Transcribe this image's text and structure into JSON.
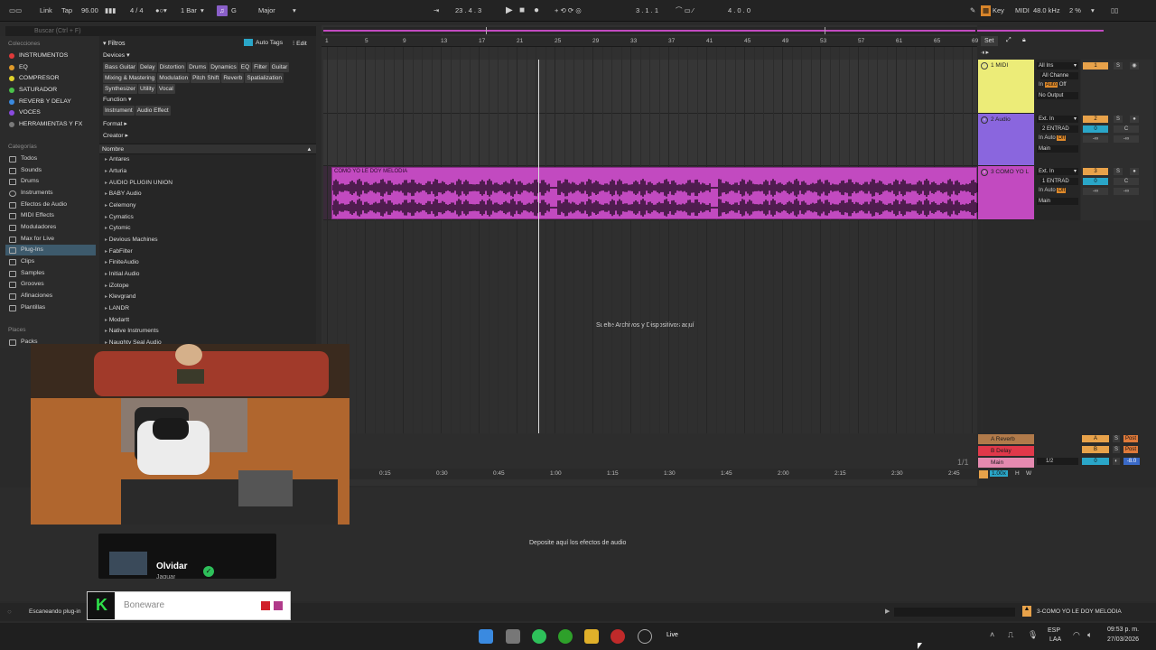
{
  "topbar": {
    "link": "Link",
    "tap": "Tap",
    "tempo": "96.00",
    "time_sig": "4 / 4",
    "quantize": "1 Bar",
    "key": "G",
    "scale": "Major",
    "position": "23 .  4 .  3",
    "loop_start": "3 .  1 .  1",
    "loop_length": "4 .  0 .  0",
    "key_label": "Key",
    "midi_label": "MIDI",
    "sample_rate": "48.0 kHz",
    "cpu": "2 %"
  },
  "browser": {
    "search_placeholder": "Buscar (Ctrl + F)",
    "collections_header": "Colecciones",
    "collections": [
      {
        "label": "INSTRUMENTOS",
        "color": "#e03a3a"
      },
      {
        "label": "EQ",
        "color": "#e09a2a"
      },
      {
        "label": "COMPRESOR",
        "color": "#e0d22a"
      },
      {
        "label": "SATURADOR",
        "color": "#4ac24a"
      },
      {
        "label": "REVERB Y DELAY",
        "color": "#3a8ae0"
      },
      {
        "label": "VOCES",
        "color": "#8a4ae0"
      },
      {
        "label": "HERRAMIENTAS Y FX",
        "color": "#7a7a7a"
      }
    ],
    "categories_header": "Categorías",
    "categories": [
      "Todos",
      "Sounds",
      "Drums",
      "Instruments",
      "Efectos de Audio",
      "MIDI Effects",
      "Moduladores",
      "Max for Live",
      "Plug-Ins",
      "Clips",
      "Samples",
      "Grooves",
      "Afinaciones",
      "Plantillas"
    ],
    "places_header": "Places",
    "places": [
      "Packs"
    ],
    "filters_label": "Filtros",
    "auto_tags": "Auto Tags",
    "edit": "Edit",
    "devices_label": "Devices",
    "device_tags": [
      "Bass Guitar",
      "Delay",
      "Distortion",
      "Drums",
      "Dynamics",
      "EQ",
      "Filter",
      "Guitar",
      "Mixing & Mastering",
      "Modulation",
      "Pitch Shift",
      "Reverb",
      "Spatialization",
      "Synthesizer",
      "Utility",
      "Vocal"
    ],
    "function_label": "Function",
    "function_tags": [
      "Instrument",
      "Audio Effect"
    ],
    "format_label": "Format",
    "creator_label": "Creator",
    "name_header": "Nombre",
    "folders": [
      "Antares",
      "Arturia",
      "AUDIO PLUGIN UNION",
      "BABY Audio",
      "Celemony",
      "Cymatics",
      "Cytomic",
      "Devious Machines",
      "FabFilter",
      "FiniteAudio",
      "Initial Audio",
      "iZotope",
      "Klevgrand",
      "LANDR",
      "Modartt",
      "Native Instruments",
      "Naughty Seal Audio"
    ]
  },
  "arrangement": {
    "ruler_labels": [
      "1",
      "5",
      "9",
      "13",
      "17",
      "21",
      "25",
      "29",
      "33",
      "37",
      "41",
      "45",
      "49",
      "53",
      "57",
      "61",
      "65",
      "69"
    ],
    "set_label": "Set",
    "clip_name": "COMO YO LE DOY MELODIA",
    "drop_files": "Suelte Archivos y Dispositivos aquí",
    "fraction": "1/1",
    "time_labels": [
      "0:15",
      "0:30",
      "0:45",
      "1:00",
      "1:15",
      "1:30",
      "1:45",
      "2:00",
      "2:15",
      "2:30",
      "2:45"
    ]
  },
  "tracks": [
    {
      "name": "1 MIDI",
      "color": "#ecec78",
      "input": "All Ins",
      "channel": "All Channe",
      "output": "No Output",
      "number": "1"
    },
    {
      "name": "2 Audio",
      "color": "#8a66de",
      "input": "Ext. In",
      "channel": "2 ENTRAD",
      "output": "Main",
      "number": "2",
      "vol": "0",
      "pan": "C",
      "send": "-∞"
    },
    {
      "name": "3 COMO YO L",
      "color": "#c24ac0",
      "input": "Ext. In",
      "channel": "1 ENTRAD",
      "output": "Main",
      "number": "3",
      "vol": "0",
      "pan": "C",
      "send": "-∞"
    }
  ],
  "monitor": {
    "in": "In",
    "auto": "Auto",
    "off": "Off"
  },
  "returns": [
    {
      "name": "A Reverb",
      "letter": "A",
      "color": "#b07a4a",
      "post": "Post"
    },
    {
      "name": "B Delay",
      "letter": "B",
      "color": "#e0384a",
      "post": "Post"
    },
    {
      "name": "Main",
      "letter": "1/2",
      "color": "#e58ab0",
      "vol": "0",
      "master": "-8.0"
    }
  ],
  "master_zoom": "1.00x",
  "h_label": "H",
  "w_label": "W",
  "device_drop": "Deposite aquí los efectos de audio",
  "status": {
    "scanning": "Escaneando plug-in",
    "selected_clip": "3-COMO YO LE DOY MELODIA"
  },
  "spotify": {
    "track": "Olvidar",
    "artist": "Jaguar"
  },
  "overlay": {
    "text": "Boneware"
  },
  "taskbar": {
    "lang": "ESP",
    "lang2": "LAA",
    "time": "09:53 p. m.",
    "date": "27/03/2026",
    "live_label": "Live"
  }
}
